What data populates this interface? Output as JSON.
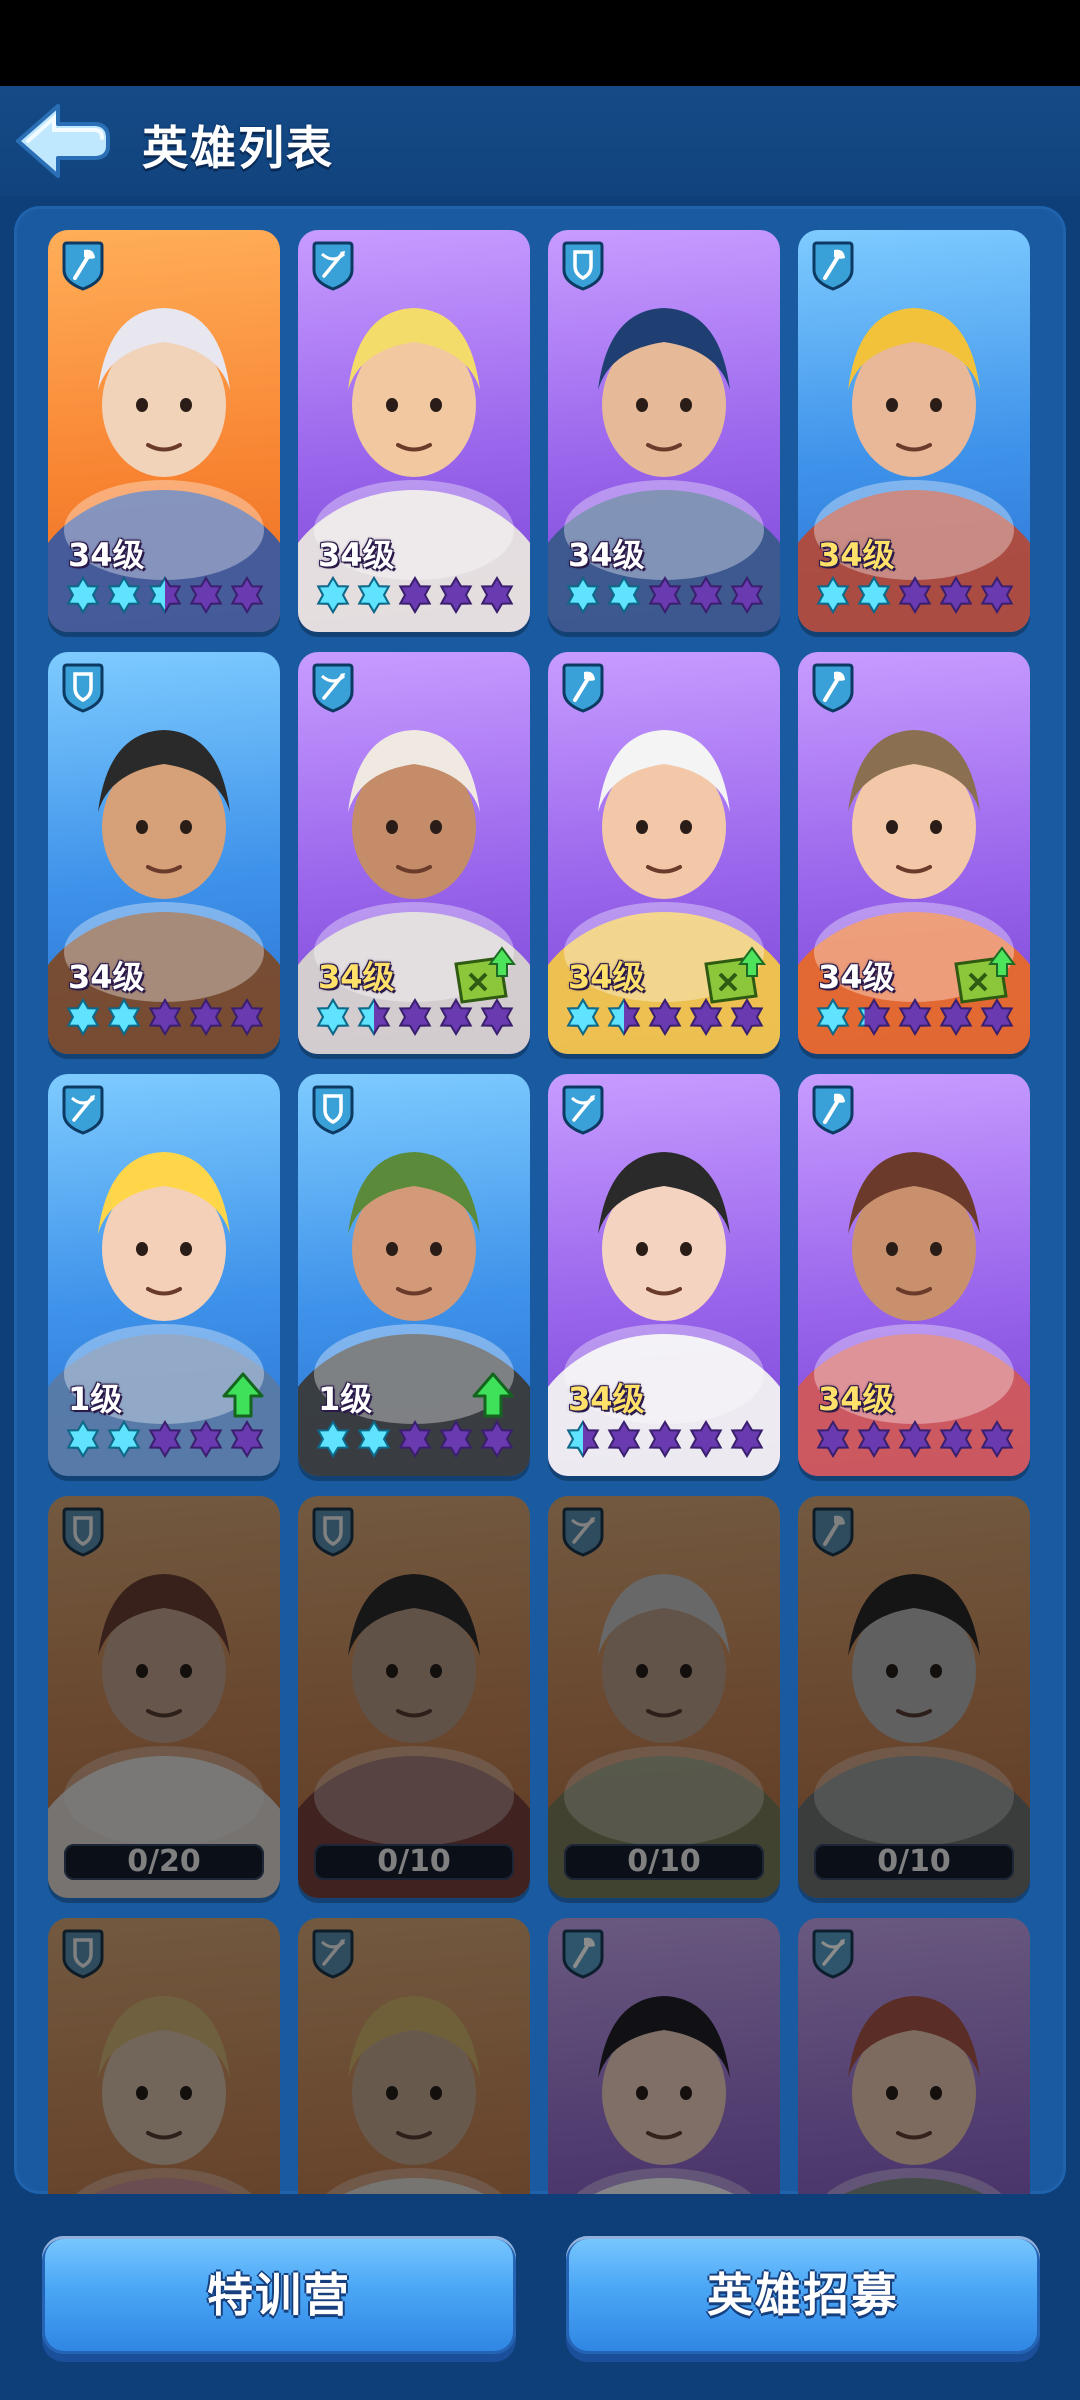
{
  "header": {
    "title": "英雄列表",
    "back_icon": "back-arrow-icon"
  },
  "heroes": [
    {
      "bg": "orange",
      "role": "axe",
      "level": "34级",
      "level_color": "white",
      "stars": 2.5,
      "upgrade": false,
      "arrow": false,
      "shard": null,
      "locked": false
    },
    {
      "bg": "purple",
      "role": "crossbow",
      "level": "34级",
      "level_color": "white",
      "stars": 2,
      "upgrade": false,
      "arrow": false,
      "shard": null,
      "locked": false
    },
    {
      "bg": "purple",
      "role": "shield",
      "level": "34级",
      "level_color": "white",
      "stars": 2,
      "upgrade": false,
      "arrow": false,
      "shard": null,
      "locked": false
    },
    {
      "bg": "blue",
      "role": "axe",
      "level": "34级",
      "level_color": "gold",
      "stars": 2,
      "upgrade": false,
      "arrow": false,
      "shard": null,
      "locked": false
    },
    {
      "bg": "blue",
      "role": "shield",
      "level": "34级",
      "level_color": "white",
      "stars": 2,
      "upgrade": false,
      "arrow": false,
      "shard": null,
      "locked": false
    },
    {
      "bg": "purple",
      "role": "crossbow",
      "level": "34级",
      "level_color": "gold",
      "stars": 1.5,
      "upgrade": true,
      "arrow": false,
      "shard": null,
      "locked": false
    },
    {
      "bg": "purple",
      "role": "axe",
      "level": "34级",
      "level_color": "gold",
      "stars": 1.5,
      "upgrade": true,
      "arrow": false,
      "shard": null,
      "locked": false
    },
    {
      "bg": "purple",
      "role": "axe",
      "level": "34级",
      "level_color": "white",
      "stars": 1.25,
      "upgrade": true,
      "arrow": false,
      "shard": null,
      "locked": false
    },
    {
      "bg": "blue",
      "role": "crossbow",
      "level": "1级",
      "level_color": "white",
      "stars": 2,
      "upgrade": false,
      "arrow": true,
      "shard": null,
      "locked": false
    },
    {
      "bg": "blue",
      "role": "shield",
      "level": "1级",
      "level_color": "white",
      "stars": 2,
      "upgrade": false,
      "arrow": true,
      "shard": null,
      "locked": false
    },
    {
      "bg": "purple",
      "role": "crossbow",
      "level": "34级",
      "level_color": "gold",
      "stars": 0.5,
      "upgrade": false,
      "arrow": false,
      "shard": null,
      "locked": false
    },
    {
      "bg": "purple",
      "role": "axe",
      "level": "34级",
      "level_color": "gold",
      "stars": 0,
      "upgrade": false,
      "arrow": false,
      "shard": null,
      "locked": false
    },
    {
      "bg": "orange",
      "role": "shield",
      "level": null,
      "stars": null,
      "upgrade": false,
      "arrow": false,
      "shard": "0/20",
      "locked": true
    },
    {
      "bg": "orange",
      "role": "shield",
      "level": null,
      "stars": null,
      "upgrade": false,
      "arrow": false,
      "shard": "0/10",
      "locked": true
    },
    {
      "bg": "orange",
      "role": "crossbow",
      "level": null,
      "stars": null,
      "upgrade": false,
      "arrow": false,
      "shard": "0/10",
      "locked": true
    },
    {
      "bg": "orange",
      "role": "axe",
      "level": null,
      "stars": null,
      "upgrade": false,
      "arrow": false,
      "shard": "0/10",
      "locked": true
    },
    {
      "bg": "orange",
      "role": "shield",
      "level": null,
      "stars": null,
      "upgrade": false,
      "arrow": false,
      "shard": null,
      "locked": true
    },
    {
      "bg": "orange",
      "role": "crossbow",
      "level": null,
      "stars": null,
      "upgrade": false,
      "arrow": false,
      "shard": null,
      "locked": true
    },
    {
      "bg": "purple",
      "role": "axe",
      "level": null,
      "stars": null,
      "upgrade": false,
      "arrow": false,
      "shard": null,
      "locked": true
    },
    {
      "bg": "purple",
      "role": "crossbow",
      "level": null,
      "stars": null,
      "upgrade": false,
      "arrow": false,
      "shard": null,
      "locked": true
    }
  ],
  "buttons": {
    "training_camp": "特训营",
    "recruit": "英雄招募"
  },
  "colors": {
    "star_filled": "#5fe3ff",
    "star_empty": "#6a3ab0",
    "level_gold": "#ffe16a"
  }
}
